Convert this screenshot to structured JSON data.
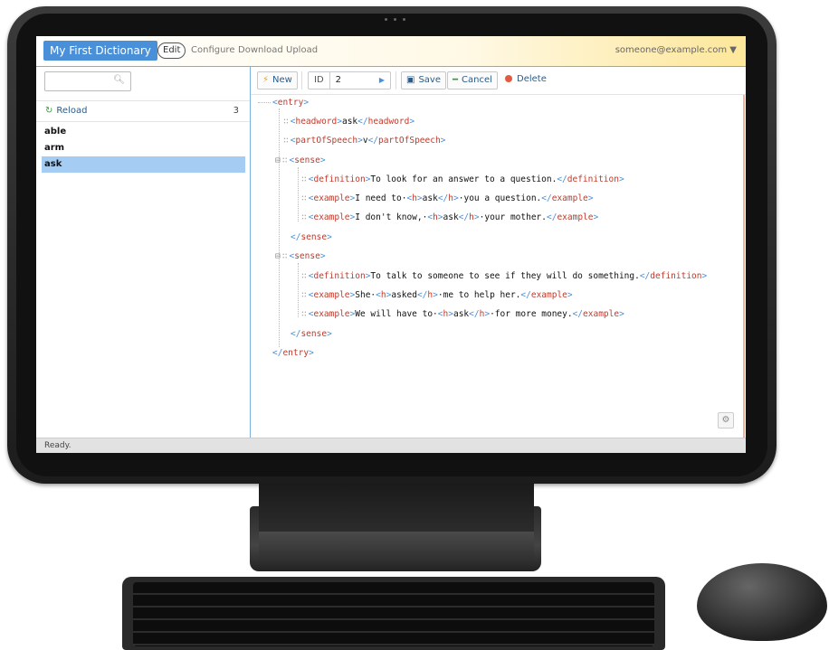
{
  "header": {
    "brand": "My First Dictionary",
    "edit": "Edit",
    "configure": "Configure",
    "download": "Download",
    "upload": "Upload",
    "user": "someone@example.com ▼"
  },
  "sidebar": {
    "search_placeholder": "",
    "reload_label": "Reload",
    "count": "3",
    "entries": [
      "able",
      "arm",
      "ask"
    ],
    "selected": "ask"
  },
  "toolbar": {
    "new_label": "New",
    "id_label": "ID",
    "id_value": "2",
    "save_label": "Save",
    "cancel_label": "Cancel",
    "delete_label": "Delete"
  },
  "xml": {
    "headword": "ask",
    "part_of_speech": "v",
    "senses": [
      {
        "definition": "To look for an answer to a question.",
        "examples": [
          {
            "before": "I need to·",
            "h": "ask",
            "after": "·you a question."
          },
          {
            "before": "I don't know,·",
            "h": "ask",
            "after": "·your mother."
          }
        ]
      },
      {
        "definition": "To talk to someone to see if they will do something.",
        "examples": [
          {
            "before": "She·",
            "h": "asked",
            "after": "·me to help her."
          },
          {
            "before": "We will have to·",
            "h": "ask",
            "after": "·for more money."
          }
        ]
      }
    ]
  },
  "status": "Ready.",
  "colors": {
    "brand": "#4a90d9",
    "tag": "#c0392b",
    "bracket": "#4a90d9",
    "selected_row": "#a5ccf2"
  }
}
